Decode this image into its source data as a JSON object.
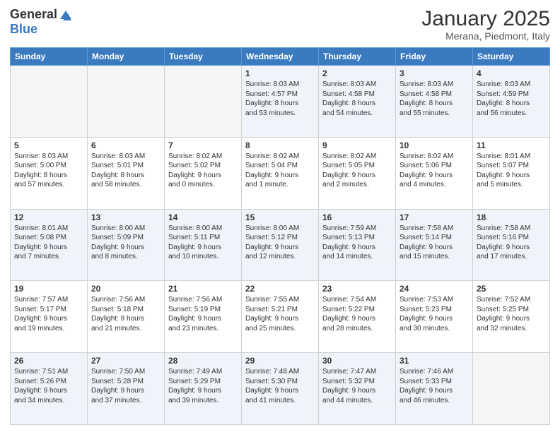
{
  "header": {
    "logo_general": "General",
    "logo_blue": "Blue",
    "month_title": "January 2025",
    "location": "Merana, Piedmont, Italy"
  },
  "weekdays": [
    "Sunday",
    "Monday",
    "Tuesday",
    "Wednesday",
    "Thursday",
    "Friday",
    "Saturday"
  ],
  "rows": [
    [
      {
        "day": "",
        "info": ""
      },
      {
        "day": "",
        "info": ""
      },
      {
        "day": "",
        "info": ""
      },
      {
        "day": "1",
        "info": "Sunrise: 8:03 AM\nSunset: 4:57 PM\nDaylight: 8 hours\nand 53 minutes."
      },
      {
        "day": "2",
        "info": "Sunrise: 8:03 AM\nSunset: 4:58 PM\nDaylight: 8 hours\nand 54 minutes."
      },
      {
        "day": "3",
        "info": "Sunrise: 8:03 AM\nSunset: 4:58 PM\nDaylight: 8 hours\nand 55 minutes."
      },
      {
        "day": "4",
        "info": "Sunrise: 8:03 AM\nSunset: 4:59 PM\nDaylight: 8 hours\nand 56 minutes."
      }
    ],
    [
      {
        "day": "5",
        "info": "Sunrise: 8:03 AM\nSunset: 5:00 PM\nDaylight: 8 hours\nand 57 minutes."
      },
      {
        "day": "6",
        "info": "Sunrise: 8:03 AM\nSunset: 5:01 PM\nDaylight: 8 hours\nand 58 minutes."
      },
      {
        "day": "7",
        "info": "Sunrise: 8:02 AM\nSunset: 5:02 PM\nDaylight: 9 hours\nand 0 minutes."
      },
      {
        "day": "8",
        "info": "Sunrise: 8:02 AM\nSunset: 5:04 PM\nDaylight: 9 hours\nand 1 minute."
      },
      {
        "day": "9",
        "info": "Sunrise: 8:02 AM\nSunset: 5:05 PM\nDaylight: 9 hours\nand 2 minutes."
      },
      {
        "day": "10",
        "info": "Sunrise: 8:02 AM\nSunset: 5:06 PM\nDaylight: 9 hours\nand 4 minutes."
      },
      {
        "day": "11",
        "info": "Sunrise: 8:01 AM\nSunset: 5:07 PM\nDaylight: 9 hours\nand 5 minutes."
      }
    ],
    [
      {
        "day": "12",
        "info": "Sunrise: 8:01 AM\nSunset: 5:08 PM\nDaylight: 9 hours\nand 7 minutes."
      },
      {
        "day": "13",
        "info": "Sunrise: 8:00 AM\nSunset: 5:09 PM\nDaylight: 9 hours\nand 8 minutes."
      },
      {
        "day": "14",
        "info": "Sunrise: 8:00 AM\nSunset: 5:11 PM\nDaylight: 9 hours\nand 10 minutes."
      },
      {
        "day": "15",
        "info": "Sunrise: 8:00 AM\nSunset: 5:12 PM\nDaylight: 9 hours\nand 12 minutes."
      },
      {
        "day": "16",
        "info": "Sunrise: 7:59 AM\nSunset: 5:13 PM\nDaylight: 9 hours\nand 14 minutes."
      },
      {
        "day": "17",
        "info": "Sunrise: 7:58 AM\nSunset: 5:14 PM\nDaylight: 9 hours\nand 15 minutes."
      },
      {
        "day": "18",
        "info": "Sunrise: 7:58 AM\nSunset: 5:16 PM\nDaylight: 9 hours\nand 17 minutes."
      }
    ],
    [
      {
        "day": "19",
        "info": "Sunrise: 7:57 AM\nSunset: 5:17 PM\nDaylight: 9 hours\nand 19 minutes."
      },
      {
        "day": "20",
        "info": "Sunrise: 7:56 AM\nSunset: 5:18 PM\nDaylight: 9 hours\nand 21 minutes."
      },
      {
        "day": "21",
        "info": "Sunrise: 7:56 AM\nSunset: 5:19 PM\nDaylight: 9 hours\nand 23 minutes."
      },
      {
        "day": "22",
        "info": "Sunrise: 7:55 AM\nSunset: 5:21 PM\nDaylight: 9 hours\nand 25 minutes."
      },
      {
        "day": "23",
        "info": "Sunrise: 7:54 AM\nSunset: 5:22 PM\nDaylight: 9 hours\nand 28 minutes."
      },
      {
        "day": "24",
        "info": "Sunrise: 7:53 AM\nSunset: 5:23 PM\nDaylight: 9 hours\nand 30 minutes."
      },
      {
        "day": "25",
        "info": "Sunrise: 7:52 AM\nSunset: 5:25 PM\nDaylight: 9 hours\nand 32 minutes."
      }
    ],
    [
      {
        "day": "26",
        "info": "Sunrise: 7:51 AM\nSunset: 5:26 PM\nDaylight: 9 hours\nand 34 minutes."
      },
      {
        "day": "27",
        "info": "Sunrise: 7:50 AM\nSunset: 5:28 PM\nDaylight: 9 hours\nand 37 minutes."
      },
      {
        "day": "28",
        "info": "Sunrise: 7:49 AM\nSunset: 5:29 PM\nDaylight: 9 hours\nand 39 minutes."
      },
      {
        "day": "29",
        "info": "Sunrise: 7:48 AM\nSunset: 5:30 PM\nDaylight: 9 hours\nand 41 minutes."
      },
      {
        "day": "30",
        "info": "Sunrise: 7:47 AM\nSunset: 5:32 PM\nDaylight: 9 hours\nand 44 minutes."
      },
      {
        "day": "31",
        "info": "Sunrise: 7:46 AM\nSunset: 5:33 PM\nDaylight: 9 hours\nand 46 minutes."
      },
      {
        "day": "",
        "info": ""
      }
    ]
  ]
}
